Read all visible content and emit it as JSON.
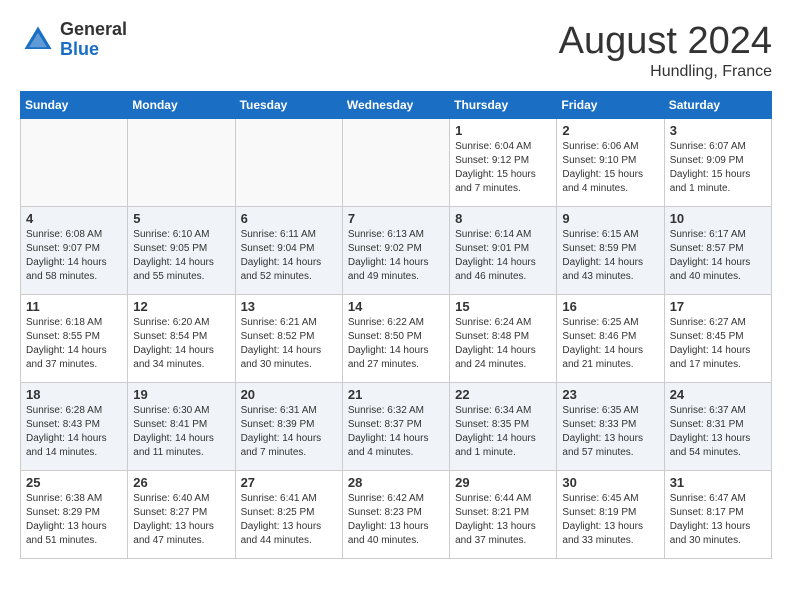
{
  "header": {
    "logo_general": "General",
    "logo_blue": "Blue",
    "month_title": "August 2024",
    "location": "Hundling, France"
  },
  "weekdays": [
    "Sunday",
    "Monday",
    "Tuesday",
    "Wednesday",
    "Thursday",
    "Friday",
    "Saturday"
  ],
  "weeks": [
    [
      {
        "day": "",
        "info": "",
        "empty": true
      },
      {
        "day": "",
        "info": "",
        "empty": true
      },
      {
        "day": "",
        "info": "",
        "empty": true
      },
      {
        "day": "",
        "info": "",
        "empty": true
      },
      {
        "day": "1",
        "info": "Sunrise: 6:04 AM\nSunset: 9:12 PM\nDaylight: 15 hours\nand 7 minutes.",
        "empty": false
      },
      {
        "day": "2",
        "info": "Sunrise: 6:06 AM\nSunset: 9:10 PM\nDaylight: 15 hours\nand 4 minutes.",
        "empty": false
      },
      {
        "day": "3",
        "info": "Sunrise: 6:07 AM\nSunset: 9:09 PM\nDaylight: 15 hours\nand 1 minute.",
        "empty": false
      }
    ],
    [
      {
        "day": "4",
        "info": "Sunrise: 6:08 AM\nSunset: 9:07 PM\nDaylight: 14 hours\nand 58 minutes.",
        "empty": false
      },
      {
        "day": "5",
        "info": "Sunrise: 6:10 AM\nSunset: 9:05 PM\nDaylight: 14 hours\nand 55 minutes.",
        "empty": false
      },
      {
        "day": "6",
        "info": "Sunrise: 6:11 AM\nSunset: 9:04 PM\nDaylight: 14 hours\nand 52 minutes.",
        "empty": false
      },
      {
        "day": "7",
        "info": "Sunrise: 6:13 AM\nSunset: 9:02 PM\nDaylight: 14 hours\nand 49 minutes.",
        "empty": false
      },
      {
        "day": "8",
        "info": "Sunrise: 6:14 AM\nSunset: 9:01 PM\nDaylight: 14 hours\nand 46 minutes.",
        "empty": false
      },
      {
        "day": "9",
        "info": "Sunrise: 6:15 AM\nSunset: 8:59 PM\nDaylight: 14 hours\nand 43 minutes.",
        "empty": false
      },
      {
        "day": "10",
        "info": "Sunrise: 6:17 AM\nSunset: 8:57 PM\nDaylight: 14 hours\nand 40 minutes.",
        "empty": false
      }
    ],
    [
      {
        "day": "11",
        "info": "Sunrise: 6:18 AM\nSunset: 8:55 PM\nDaylight: 14 hours\nand 37 minutes.",
        "empty": false
      },
      {
        "day": "12",
        "info": "Sunrise: 6:20 AM\nSunset: 8:54 PM\nDaylight: 14 hours\nand 34 minutes.",
        "empty": false
      },
      {
        "day": "13",
        "info": "Sunrise: 6:21 AM\nSunset: 8:52 PM\nDaylight: 14 hours\nand 30 minutes.",
        "empty": false
      },
      {
        "day": "14",
        "info": "Sunrise: 6:22 AM\nSunset: 8:50 PM\nDaylight: 14 hours\nand 27 minutes.",
        "empty": false
      },
      {
        "day": "15",
        "info": "Sunrise: 6:24 AM\nSunset: 8:48 PM\nDaylight: 14 hours\nand 24 minutes.",
        "empty": false
      },
      {
        "day": "16",
        "info": "Sunrise: 6:25 AM\nSunset: 8:46 PM\nDaylight: 14 hours\nand 21 minutes.",
        "empty": false
      },
      {
        "day": "17",
        "info": "Sunrise: 6:27 AM\nSunset: 8:45 PM\nDaylight: 14 hours\nand 17 minutes.",
        "empty": false
      }
    ],
    [
      {
        "day": "18",
        "info": "Sunrise: 6:28 AM\nSunset: 8:43 PM\nDaylight: 14 hours\nand 14 minutes.",
        "empty": false
      },
      {
        "day": "19",
        "info": "Sunrise: 6:30 AM\nSunset: 8:41 PM\nDaylight: 14 hours\nand 11 minutes.",
        "empty": false
      },
      {
        "day": "20",
        "info": "Sunrise: 6:31 AM\nSunset: 8:39 PM\nDaylight: 14 hours\nand 7 minutes.",
        "empty": false
      },
      {
        "day": "21",
        "info": "Sunrise: 6:32 AM\nSunset: 8:37 PM\nDaylight: 14 hours\nand 4 minutes.",
        "empty": false
      },
      {
        "day": "22",
        "info": "Sunrise: 6:34 AM\nSunset: 8:35 PM\nDaylight: 14 hours\nand 1 minute.",
        "empty": false
      },
      {
        "day": "23",
        "info": "Sunrise: 6:35 AM\nSunset: 8:33 PM\nDaylight: 13 hours\nand 57 minutes.",
        "empty": false
      },
      {
        "day": "24",
        "info": "Sunrise: 6:37 AM\nSunset: 8:31 PM\nDaylight: 13 hours\nand 54 minutes.",
        "empty": false
      }
    ],
    [
      {
        "day": "25",
        "info": "Sunrise: 6:38 AM\nSunset: 8:29 PM\nDaylight: 13 hours\nand 51 minutes.",
        "empty": false
      },
      {
        "day": "26",
        "info": "Sunrise: 6:40 AM\nSunset: 8:27 PM\nDaylight: 13 hours\nand 47 minutes.",
        "empty": false
      },
      {
        "day": "27",
        "info": "Sunrise: 6:41 AM\nSunset: 8:25 PM\nDaylight: 13 hours\nand 44 minutes.",
        "empty": false
      },
      {
        "day": "28",
        "info": "Sunrise: 6:42 AM\nSunset: 8:23 PM\nDaylight: 13 hours\nand 40 minutes.",
        "empty": false
      },
      {
        "day": "29",
        "info": "Sunrise: 6:44 AM\nSunset: 8:21 PM\nDaylight: 13 hours\nand 37 minutes.",
        "empty": false
      },
      {
        "day": "30",
        "info": "Sunrise: 6:45 AM\nSunset: 8:19 PM\nDaylight: 13 hours\nand 33 minutes.",
        "empty": false
      },
      {
        "day": "31",
        "info": "Sunrise: 6:47 AM\nSunset: 8:17 PM\nDaylight: 13 hours\nand 30 minutes.",
        "empty": false
      }
    ]
  ]
}
